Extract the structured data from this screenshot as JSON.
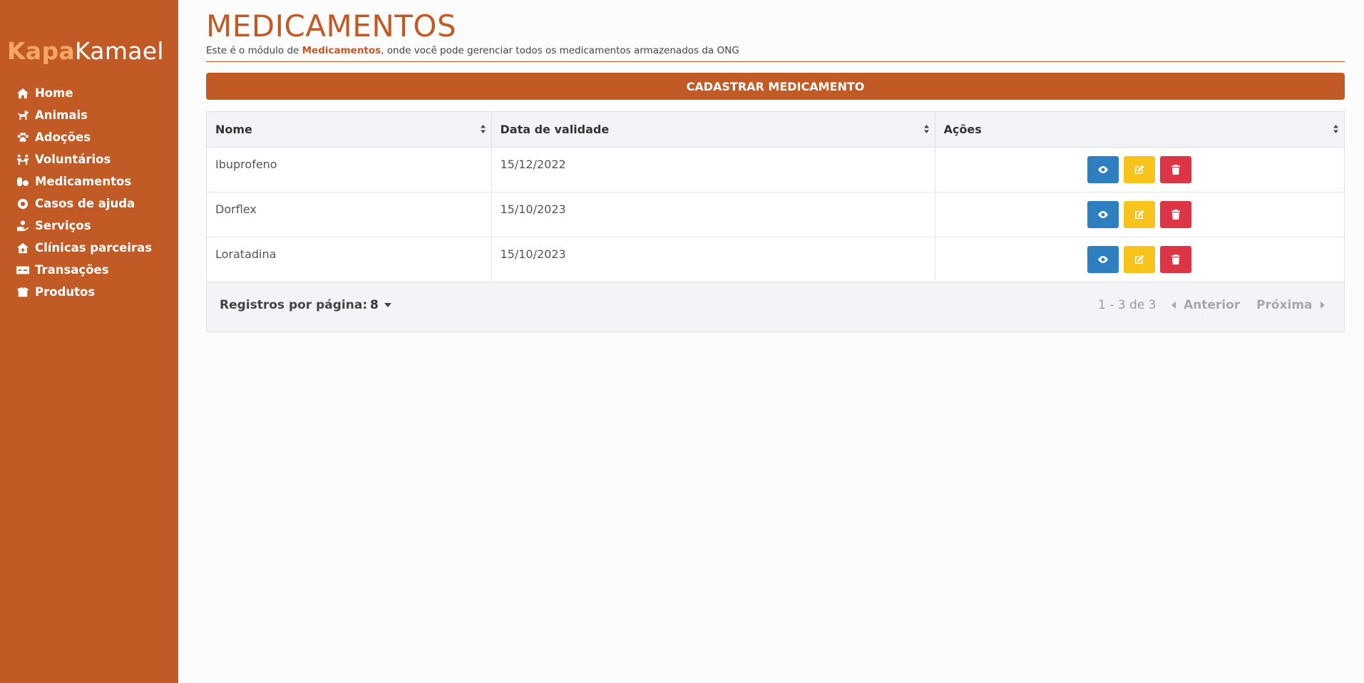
{
  "brand": {
    "part1": "Kapa",
    "part2": "Kamael"
  },
  "sidebar": {
    "items": [
      {
        "label": "Home",
        "icon": "home-icon"
      },
      {
        "label": "Animais",
        "icon": "dog-icon"
      },
      {
        "label": "Adoções",
        "icon": "paw-icon"
      },
      {
        "label": "Voluntários",
        "icon": "people-icon"
      },
      {
        "label": "Medicamentos",
        "icon": "pills-icon"
      },
      {
        "label": "Casos de ajuda",
        "icon": "lifebuoy-icon"
      },
      {
        "label": "Serviços",
        "icon": "hand-holding-icon"
      },
      {
        "label": "Clínicas parceiras",
        "icon": "clinic-icon"
      },
      {
        "label": "Transações",
        "icon": "money-icon"
      },
      {
        "label": "Produtos",
        "icon": "box-icon"
      }
    ]
  },
  "page": {
    "title": "MEDICAMENTOS",
    "subtitle_prefix": "Este é o módulo de ",
    "subtitle_highlight": "Medicamentos",
    "subtitle_suffix": ", onde você pode gerenciar todos os medicamentos armazenados da ONG",
    "add_button": "CADASTRAR MEDICAMENTO"
  },
  "table": {
    "columns": [
      "Nome",
      "Data de validade",
      "Ações"
    ],
    "rows": [
      {
        "nome": "Ibuprofeno",
        "validade": "15/12/2022"
      },
      {
        "nome": "Dorflex",
        "validade": "15/10/2023"
      },
      {
        "nome": "Loratadina",
        "validade": "15/10/2023"
      }
    ]
  },
  "pagination": {
    "rows_per_page_label": "Registros por página:",
    "rows_per_page_value": "8",
    "range": "1 - 3 de 3",
    "prev": "Anterior",
    "next": "Próxima"
  },
  "colors": {
    "brand": "#c25a26",
    "view": "#2e7fbf",
    "edit": "#f8c31a",
    "delete": "#dc3545"
  }
}
